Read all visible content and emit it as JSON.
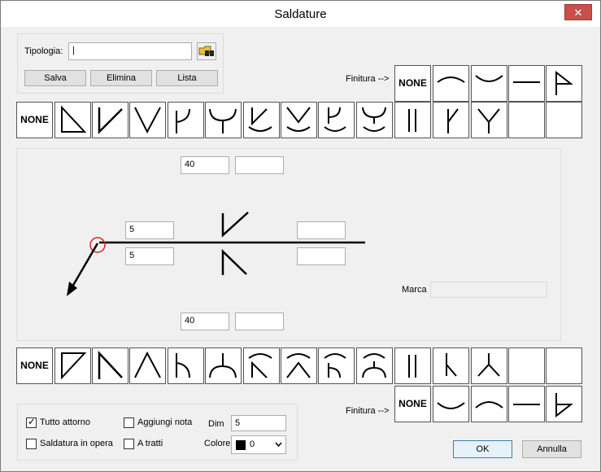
{
  "window": {
    "title": "Saldature",
    "close_glyph": "✕"
  },
  "tipologia": {
    "label": "Tipologia:",
    "value": "|",
    "browse_icon": "folder-binoculars-icon",
    "buttons": {
      "salva": "Salva",
      "elimina": "Elimina",
      "lista": "Lista"
    }
  },
  "finitura_top": {
    "label": "Finitura -->",
    "symbols": [
      "NONE",
      "convex-arc",
      "concave-arc",
      "flat",
      "flag"
    ]
  },
  "top_weld_symbols": [
    "NONE",
    "fillet",
    "v-half",
    "v",
    "bevel-j",
    "u",
    "v-backing",
    "v-double-arc",
    "j-arc",
    "u-arc",
    "square-double",
    "single-bevel-line",
    "y",
    "",
    ""
  ],
  "weld_panel": {
    "top_dim_1": "40",
    "top_dim_2": "",
    "left_upper_size": "5",
    "left_lower_size": "5",
    "right_upper": "",
    "right_lower": "",
    "bottom_dim_1": "40",
    "bottom_dim_2": "",
    "marca_label": "Marca",
    "marca_value": ""
  },
  "bottom_weld_symbols": [
    "NONE",
    "fillet",
    "v-half",
    "v",
    "bevel-j",
    "u",
    "v-backing",
    "v-double-arc",
    "j-arc",
    "u-arc",
    "square-double",
    "single-bevel-line",
    "y",
    "",
    ""
  ],
  "finitura_bottom": {
    "label": "Finitura -->",
    "symbols": [
      "NONE",
      "concave-arc",
      "convex-arc",
      "flat",
      "flag"
    ]
  },
  "options": {
    "tutto_attorno": {
      "label": "Tutto attorno",
      "checked": true
    },
    "saldatura_in_opera": {
      "label": "Saldatura in opera",
      "checked": false
    },
    "aggiungi_nota": {
      "label": "Aggiungi nota",
      "checked": false
    },
    "a_tratti": {
      "label": "A tratti",
      "checked": false
    },
    "dim_label": "Dim",
    "dim_value": "5",
    "colore_label": "Colore",
    "colore_value": "0",
    "colore_hex": "#000000"
  },
  "actions": {
    "ok": "OK",
    "annulla": "Annulla"
  }
}
